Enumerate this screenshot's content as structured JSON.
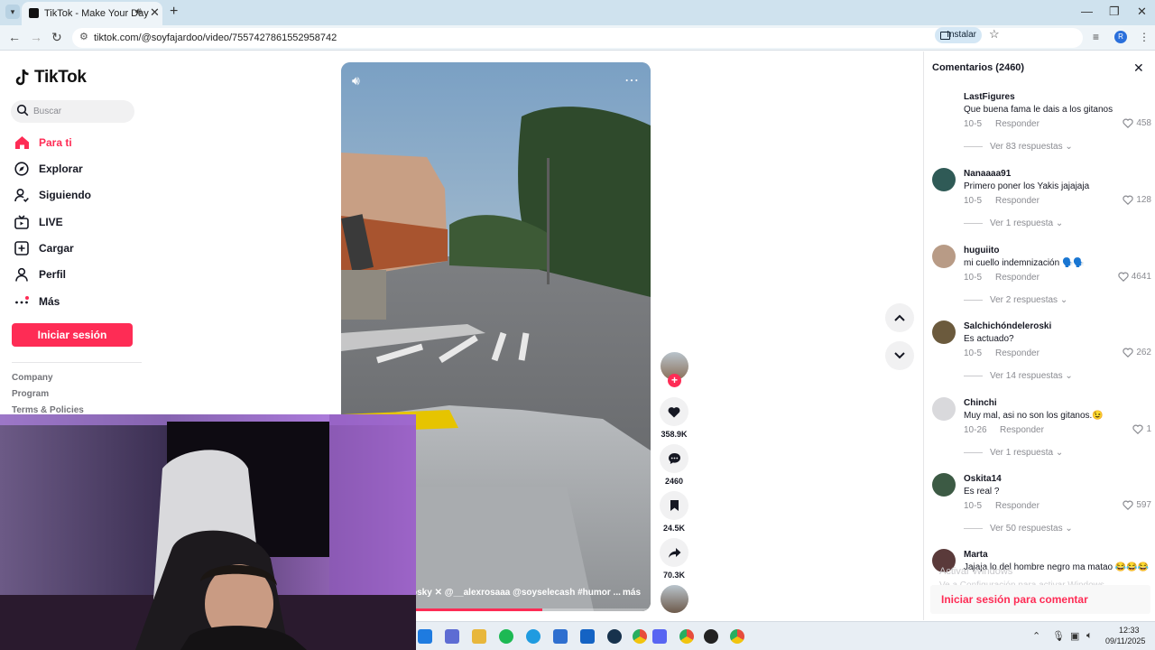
{
  "browser": {
    "tab_title": "TikTok - Make Your Day",
    "url": "tiktok.com/@soyfajardoo/video/7557427861552958742",
    "install_label": "Instalar",
    "profile_initial": "R"
  },
  "sidebar": {
    "logo": "TikTok",
    "search_placeholder": "Buscar",
    "items": [
      {
        "label": "Para ti",
        "icon": "home-icon",
        "active": true
      },
      {
        "label": "Explorar",
        "icon": "compass-icon"
      },
      {
        "label": "Siguiendo",
        "icon": "following-icon"
      },
      {
        "label": "LIVE",
        "icon": "live-icon"
      },
      {
        "label": "Cargar",
        "icon": "upload-icon"
      },
      {
        "label": "Perfil",
        "icon": "profile-icon"
      },
      {
        "label": "Más",
        "icon": "more-icon"
      }
    ],
    "login_button": "Iniciar sesión",
    "footer_links": [
      "Company",
      "Program",
      "Terms & Policies"
    ]
  },
  "video": {
    "caption": "osky ✕ @__alexrosaaa @soyselecash #humor ...",
    "caption_more": "más",
    "progress": 0.65
  },
  "actions": {
    "likes": "358.9K",
    "comments": "2460",
    "saves": "24.5K",
    "shares": "70.3K"
  },
  "comments": {
    "header": "Comentarios (2460)",
    "reply_label": "Responder",
    "items": [
      {
        "user": "LastFigures",
        "text": "Que buena fama le dais a los gitanos",
        "date": "10-5",
        "likes": "458",
        "more": "Ver 83 respuestas",
        "avatar_color": "#ffffff"
      },
      {
        "user": "Nanaaaa91",
        "text": "Primero poner los Yakis jajajaja",
        "date": "10-5",
        "likes": "128",
        "more": "Ver 1 respuesta",
        "avatar_color": "#2f5a56"
      },
      {
        "user": "huguiito",
        "text": "mi cuello indemnización 🗣️🗣️",
        "date": "10-5",
        "likes": "4641",
        "more": "Ver 2 respuestas",
        "avatar_color": "#b89b86"
      },
      {
        "user": "Salchichóndeleroski",
        "text": "Es actuado?",
        "date": "10-5",
        "likes": "262",
        "more": "Ver 14 respuestas",
        "avatar_color": "#6b5a3d"
      },
      {
        "user": "Chinchi",
        "text": "Muy mal, asi no son los gitanos.😉",
        "date": "10-26",
        "likes": "1",
        "more": "Ver 1 respuesta",
        "avatar_color": "#d9d9dc"
      },
      {
        "user": "Oskita14",
        "text": "Es real ?",
        "date": "10-5",
        "likes": "597",
        "more": "Ver 50 respuestas",
        "avatar_color": "#3c5a44"
      },
      {
        "user": "Marta",
        "text": "Jajaja lo del hombre negro ma matao 😂😂😂",
        "date": "",
        "likes": "",
        "more": "",
        "avatar_color": "#5a3a3a"
      }
    ],
    "login_prompt": "Iniciar sesión para comentar"
  },
  "system": {
    "watermark_title": "Activar Windows",
    "watermark_sub": "Ve a Configuración para activar Windows.",
    "time": "12:33",
    "date": "09/11/2025"
  }
}
